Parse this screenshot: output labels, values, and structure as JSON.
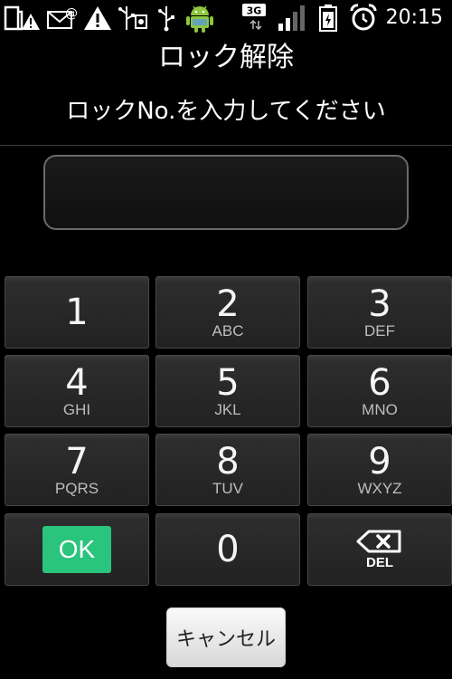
{
  "status_bar": {
    "time": "20:15",
    "network_label": "3G",
    "icons": [
      "sd-card-warning-icon",
      "mail-notification-icon",
      "warning-icon",
      "usb-debug-icon",
      "usb-icon",
      "android-icon",
      "signal-icon",
      "battery-icon",
      "alarm-icon"
    ]
  },
  "screen": {
    "title": "ロック解除",
    "prompt": "ロックNo.を入力してください",
    "pin_value": ""
  },
  "keypad": {
    "keys": [
      {
        "digit": "1",
        "letters": ""
      },
      {
        "digit": "2",
        "letters": "ABC"
      },
      {
        "digit": "3",
        "letters": "DEF"
      },
      {
        "digit": "4",
        "letters": "GHI"
      },
      {
        "digit": "5",
        "letters": "JKL"
      },
      {
        "digit": "6",
        "letters": "MNO"
      },
      {
        "digit": "7",
        "letters": "PQRS"
      },
      {
        "digit": "8",
        "letters": "TUV"
      },
      {
        "digit": "9",
        "letters": "WXYZ"
      }
    ],
    "ok_label": "OK",
    "zero": "0",
    "del_label": "DEL"
  },
  "cancel_label": "キャンセル",
  "colors": {
    "ok_green": "#2bc47d",
    "background": "#000000",
    "key_bg": "#262626"
  }
}
